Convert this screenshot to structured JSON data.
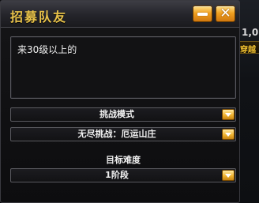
{
  "dialog": {
    "title": "招募队友",
    "minimize_label": "—",
    "close_label": "✕",
    "message": "来30级以上的",
    "mode_select": {
      "selected": "挑战模式"
    },
    "dungeon_select": {
      "selected": "无尽挑战：厄运山庄"
    },
    "difficulty_label": "目标难度",
    "difficulty_select": {
      "selected": "1阶段"
    }
  },
  "background": {
    "peek_number": "1,0",
    "peek_gold_text": "穿越"
  },
  "colors": {
    "title": "#e8c24a",
    "button_gold": "#f0a020",
    "text": "#f0f0f0",
    "border": "#5a5a60"
  }
}
